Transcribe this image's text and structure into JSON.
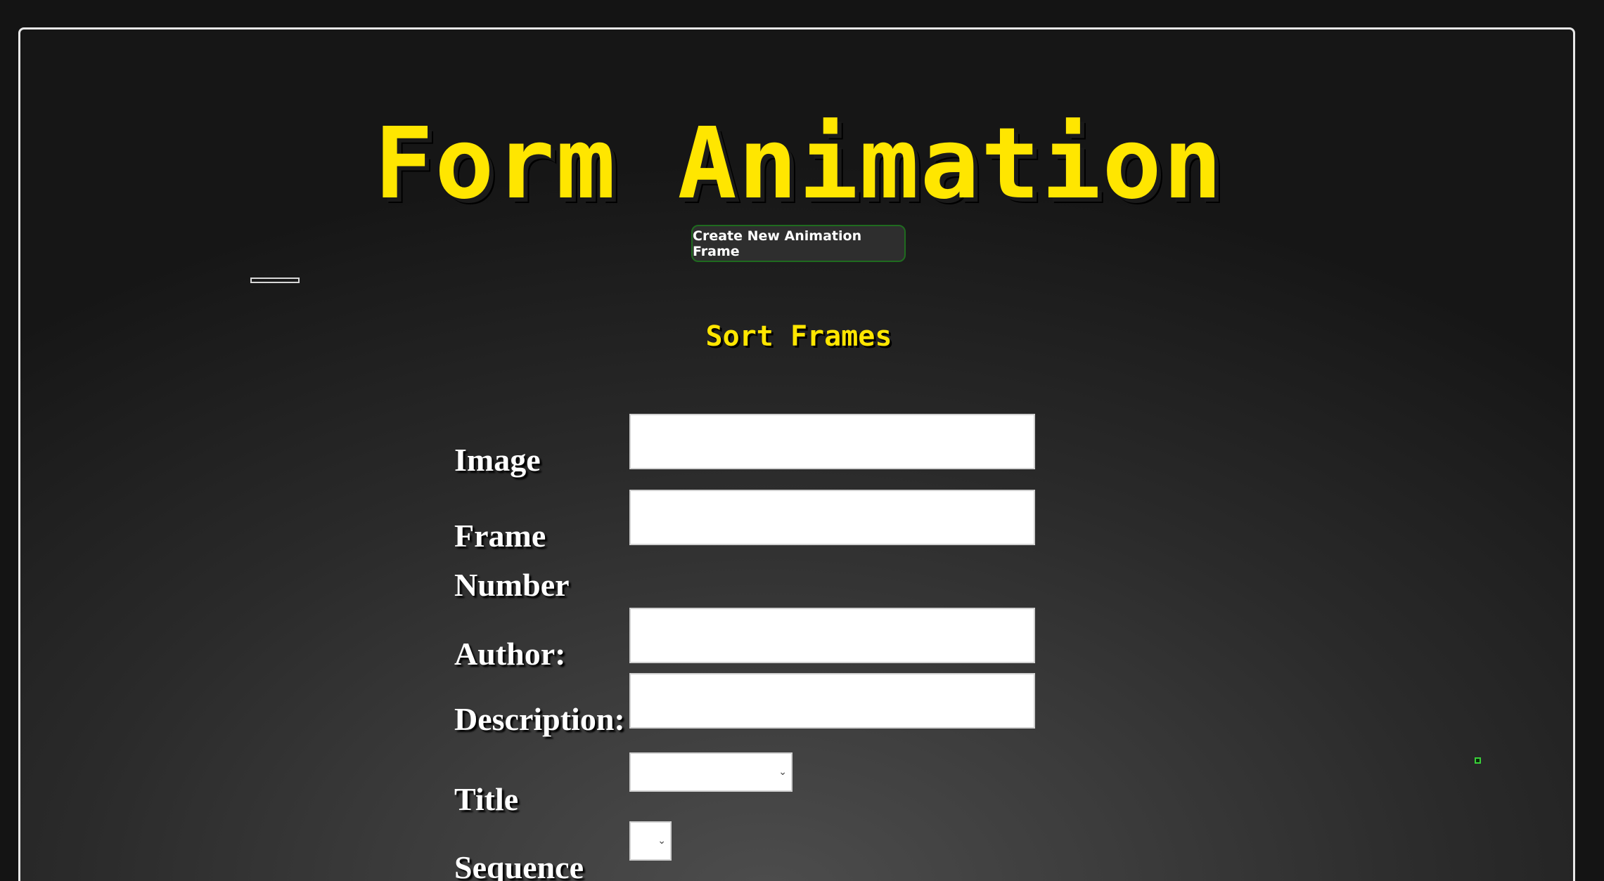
{
  "header": {
    "title": "Form Animation",
    "create_button_label": "Create New Animation Frame",
    "sort_link_label": "Sort Frames"
  },
  "form": {
    "image_label": "Image",
    "frame_number_label": "Frame Number",
    "author_label": "Author:",
    "description_label": "Description:",
    "title_label": "Title",
    "sequence_label": "Sequence",
    "image_value": "",
    "frame_number_value": "",
    "author_value": "",
    "description_value": "",
    "title_selected": "",
    "sequence_selected": ""
  },
  "icons": {
    "dropdown": "chevron-down-icon"
  },
  "colors": {
    "accent_yellow": "#ffe600",
    "button_border_green": "#1f6b1f",
    "indicator_green": "#39d039",
    "label_white": "#ffffff"
  }
}
